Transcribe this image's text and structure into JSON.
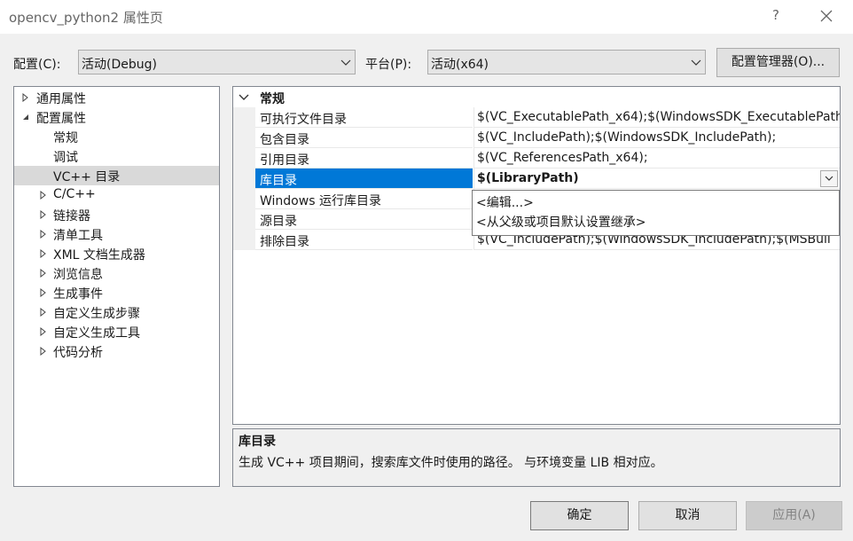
{
  "window": {
    "title": "opencv_python2 属性页",
    "help_label": "?"
  },
  "config": {
    "label": "配置(C):",
    "value": "活动(Debug)"
  },
  "platform": {
    "label": "平台(P):",
    "value": "活动(x64)"
  },
  "config_manager_label": "配置管理器(O)...",
  "tree": {
    "items": [
      {
        "label": "通用属性",
        "expander": "collapsed"
      },
      {
        "label": "配置属性",
        "expander": "expanded"
      },
      {
        "label": "常规",
        "expander": "none"
      },
      {
        "label": "调试",
        "expander": "none"
      },
      {
        "label": "VC++ 目录",
        "expander": "none",
        "selected": true
      },
      {
        "label": "C/C++",
        "expander": "collapsed"
      },
      {
        "label": "链接器",
        "expander": "collapsed"
      },
      {
        "label": "清单工具",
        "expander": "collapsed"
      },
      {
        "label": "XML 文档生成器",
        "expander": "collapsed"
      },
      {
        "label": "浏览信息",
        "expander": "collapsed"
      },
      {
        "label": "生成事件",
        "expander": "collapsed"
      },
      {
        "label": "自定义生成步骤",
        "expander": "collapsed"
      },
      {
        "label": "自定义生成工具",
        "expander": "collapsed"
      },
      {
        "label": "代码分析",
        "expander": "collapsed"
      }
    ]
  },
  "grid": {
    "category": "常规",
    "rows": [
      {
        "name": "可执行文件目录",
        "value": "$(VC_ExecutablePath_x64);$(WindowsSDK_ExecutablePath"
      },
      {
        "name": "包含目录",
        "value": "$(VC_IncludePath);$(WindowsSDK_IncludePath);"
      },
      {
        "name": "引用目录",
        "value": "$(VC_ReferencesPath_x64);"
      },
      {
        "name": "库目录",
        "value": "$(LibraryPath)",
        "selected": true
      },
      {
        "name": "Windows 运行库目录",
        "value": ""
      },
      {
        "name": "源目录",
        "value": ""
      },
      {
        "name": "排除目录",
        "value": "$(VC_IncludePath);$(WindowsSDK_IncludePath);$(MSBuil"
      }
    ]
  },
  "dropdown": {
    "options": [
      "<编辑...>",
      "<从父级或项目默认设置继承>"
    ]
  },
  "description": {
    "title": "库目录",
    "text": "生成 VC++ 项目期间，搜索库文件时使用的路径。 与环境变量 LIB 相对应。"
  },
  "buttons": {
    "ok": "确定",
    "cancel": "取消",
    "apply": "应用(A)"
  }
}
